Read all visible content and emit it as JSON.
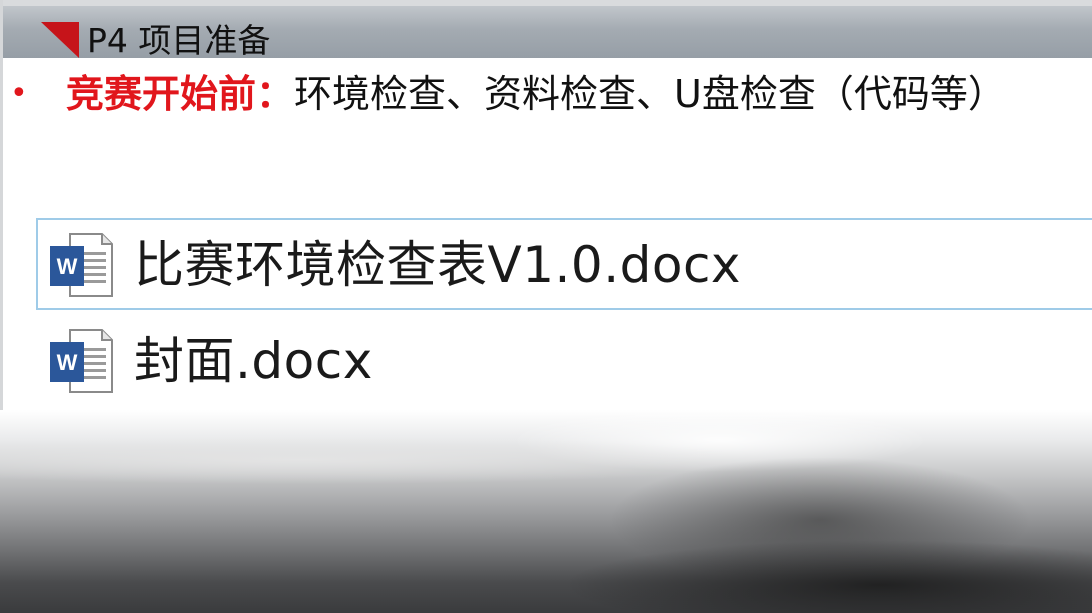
{
  "slide": {
    "title": "P4 项目准备",
    "bullet": {
      "marker": "•",
      "label": "竞赛开始前：",
      "text": "环境检查、资料检查、U盘检查（代码等）"
    },
    "files": [
      {
        "name": "比赛环境检查表V1.0.docx",
        "icon": "word-document-icon",
        "selected": true
      },
      {
        "name": "封面.docx",
        "icon": "word-document-icon",
        "selected": false
      }
    ]
  },
  "colors": {
    "accent_red": "#e1161c",
    "title_mark": "#c6141a",
    "selection_border": "#9fcbe8",
    "word_blue": "#2b579a"
  }
}
